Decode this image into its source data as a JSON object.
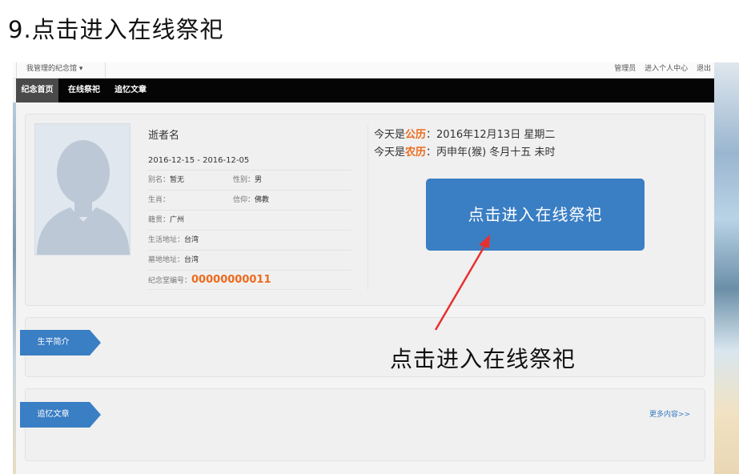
{
  "step_title": "9.点击进入在线祭祀",
  "topbar": {
    "my_halls": "我管理的纪念馆",
    "admin": "管理员",
    "personal_center": "进入个人中心",
    "logout": "退出"
  },
  "nav": {
    "tabs": [
      {
        "label": "纪念首页",
        "active": true
      },
      {
        "label": "在线祭祀",
        "active": false
      },
      {
        "label": "追忆文章",
        "active": false
      }
    ]
  },
  "profile": {
    "name": "逝者名",
    "dates": "2016-12-15 - 2016-12-05",
    "alias_label": "别名：",
    "alias_value": "暂无",
    "gender_label": "性别：",
    "gender_value": "男",
    "zodiac_label": "生肖：",
    "zodiac_value": "",
    "faith_label": "信仰：",
    "faith_value": "佛教",
    "native_label": "籍贯：",
    "native_value": "广州",
    "residence_label": "生活地址：",
    "residence_value": "台湾",
    "grave_label": "墓地地址：",
    "grave_value": "台湾",
    "hall_no_label": "纪念堂编号：",
    "hall_no_value": "00000000011"
  },
  "calendar": {
    "prefix": "今天是",
    "solar_label": "公历",
    "solar_value": "：2016年12月13日 星期二",
    "lunar_label": "农历",
    "lunar_value": "：丙申年(猴) 冬月十五 未时"
  },
  "enter_button": "点击进入在线祭祀",
  "sections": {
    "bio": "生平简介",
    "articles": "追忆文章",
    "more": "更多内容>>"
  },
  "annotation": "点击进入在线祭祀",
  "colors": {
    "accent_blue": "#3a7ec4",
    "highlight_orange": "#ee6a1c",
    "arrow_red": "#e8302f",
    "nav_bg": "#050505"
  }
}
